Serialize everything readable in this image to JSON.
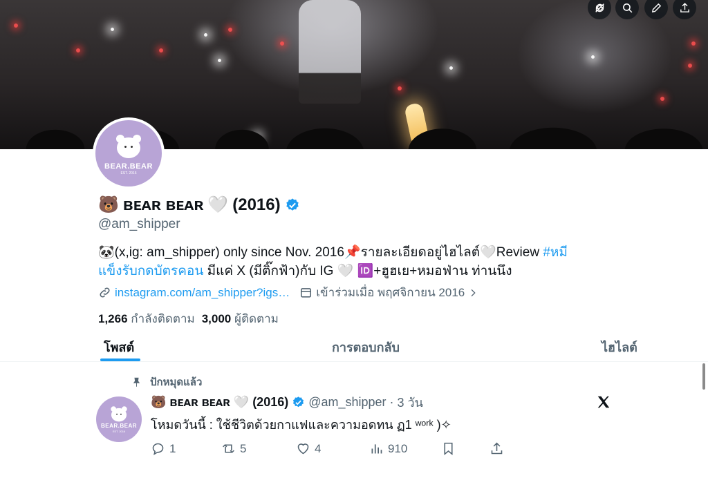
{
  "banner_actions": [
    "refresh-icon",
    "search-icon",
    "edit-icon",
    "share-icon"
  ],
  "profile": {
    "avatar": {
      "name": "BEAR.BEAR",
      "est": "EST. 2016"
    },
    "display_name_emoji": "🐻",
    "display_name": "ʙᴇᴀʀ ʙᴇᴀʀ",
    "display_name_heart": "🤍",
    "display_name_year": "(2016)",
    "verified": true,
    "handle": "@am_shipper",
    "bio_line1_text": "🐼(x,ig: am_shipper) only since Nov. 2016📌รายละเอียดอยู่ไฮไลต์🤍Review ",
    "bio_line1_hashtag": "#หมี",
    "bio_line2_hashtag": "แข็งรับกดบัตรคอน",
    "bio_line2_text": " มีแค่ X (มีติ๊กฟ้า)กับ IG 🤍 🆔+ฮูฮเย+หมอฟ่าน ท่านนึง",
    "link": "instagram.com/am_shipper?igs…",
    "joined": "เข้าร่วมเมื่อ พฤศจิกายน 2016",
    "following_count": "1,266",
    "following_label": "กำลังติดตาม",
    "followers_count": "3,000",
    "followers_label": "ผู้ติดตาม"
  },
  "tabs": [
    {
      "label": "โพสต์",
      "active": true
    },
    {
      "label": "การตอบกลับ",
      "active": false
    },
    {
      "label": "ไฮไลต์",
      "active": false
    }
  ],
  "post": {
    "pinned_label": "ปักหมุดแล้ว",
    "avatar": {
      "name": "BEAR.BEAR",
      "est": "EST. 2016"
    },
    "author_emoji": "🐻",
    "author_name": "ʙᴇᴀʀ ʙᴇᴀʀ",
    "author_heart": "🤍",
    "author_year": "(2016)",
    "handle": "@am_shipper",
    "separator": "·",
    "time": "3 วัน",
    "text": "โหมดวันนี้ : ใช้ชีวิตด้วยกาแฟและความอดทน ฏ1 ʷᵒʳᵏ )✧",
    "replies": "1",
    "reposts": "5",
    "likes": "4",
    "views": "910"
  },
  "colors": {
    "accent": "#1d9bf0",
    "text": "#0f1419",
    "secondary": "#536471",
    "avatar_bg": "#b8a4d6"
  }
}
